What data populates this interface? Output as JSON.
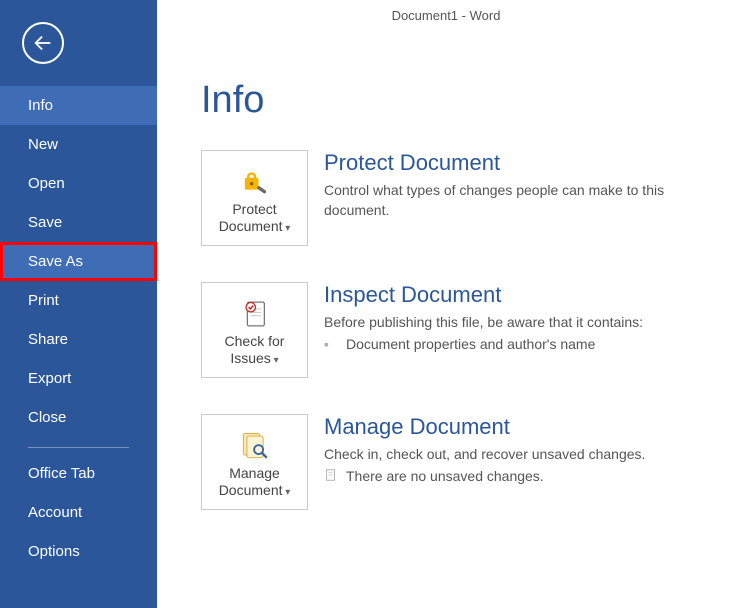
{
  "window": {
    "title": "Document1 - Word"
  },
  "page": {
    "heading": "Info"
  },
  "sidebar": {
    "items": [
      {
        "label": "Info"
      },
      {
        "label": "New"
      },
      {
        "label": "Open"
      },
      {
        "label": "Save"
      },
      {
        "label": "Save As"
      },
      {
        "label": "Print"
      },
      {
        "label": "Share"
      },
      {
        "label": "Export"
      },
      {
        "label": "Close"
      }
    ],
    "footer": [
      {
        "label": "Office Tab"
      },
      {
        "label": "Account"
      },
      {
        "label": "Options"
      }
    ]
  },
  "sections": {
    "protect": {
      "tile_line1": "Protect",
      "tile_line2": "Document",
      "title": "Protect Document",
      "desc": "Control what types of changes people can make to this document."
    },
    "inspect": {
      "tile_line1": "Check for",
      "tile_line2": "Issues",
      "title": "Inspect Document",
      "desc": "Before publishing this file, be aware that it contains:",
      "bullet": "Document properties and author's name"
    },
    "manage": {
      "tile_line1": "Manage",
      "tile_line2": "Document",
      "title": "Manage Document",
      "desc": "Check in, check out, and recover unsaved changes.",
      "bullet": "There are no unsaved changes."
    }
  }
}
